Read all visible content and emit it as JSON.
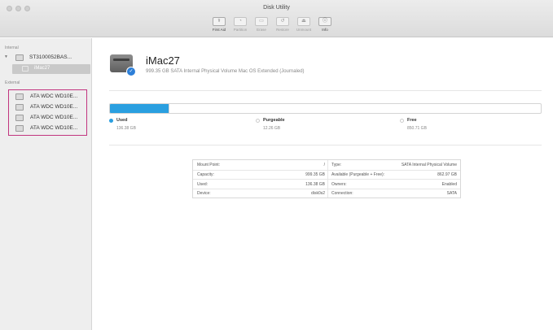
{
  "window": {
    "title": "Disk Utility"
  },
  "toolbar": {
    "items": [
      {
        "label": "First Aid",
        "icon": "first-aid-icon",
        "glyph": "⚕"
      },
      {
        "label": "Partition",
        "icon": "partition-icon",
        "glyph": "◔"
      },
      {
        "label": "Erase",
        "icon": "erase-icon",
        "glyph": "▭"
      },
      {
        "label": "Restore",
        "icon": "restore-icon",
        "glyph": "↺"
      },
      {
        "label": "Unmount",
        "icon": "unmount-icon",
        "glyph": "⏏"
      },
      {
        "label": "Info",
        "icon": "info-icon",
        "glyph": "ⓘ"
      }
    ]
  },
  "sidebar": {
    "internal_label": "Internal",
    "internal_disk": "ST3100052BAS...",
    "internal_volume": "iMac27",
    "external_label": "External",
    "external_disks": [
      "ATA WDC WD10E...",
      "ATA WDC WD10E...",
      "ATA WDC WD10E...",
      "ATA WDC WD10E..."
    ]
  },
  "volume": {
    "name": "iMac27",
    "description": "999.35 GB SATA Internal Physical Volume Mac OS Extended (Journaled)"
  },
  "usage": {
    "used_fraction": 0.137,
    "purgeable_fraction": 0.012,
    "used_label": "Used",
    "used_value": "136.38 GB",
    "purgeable_label": "Purgeable",
    "purgeable_value": "12.26 GB",
    "free_label": "Free",
    "free_value": "850.71 GB",
    "colors": {
      "used": "#2a9fe0",
      "purgeable": "#ffffff",
      "free": "#ffffff"
    }
  },
  "info": {
    "rows": [
      {
        "label": "Mount Point:",
        "value": "/",
        "label2": "Type:",
        "value2": "SATA Internal Physical Volume"
      },
      {
        "label": "Capacity:",
        "value": "999.35 GB",
        "label2": "Available (Purgeable + Free):",
        "value2": "862.97 GB"
      },
      {
        "label": "Used:",
        "value": "136.38 GB",
        "label2": "Owners:",
        "value2": "Enabled"
      },
      {
        "label": "Device:",
        "value": "disk0s2",
        "label2": "Connection:",
        "value2": "SATA"
      }
    ]
  }
}
